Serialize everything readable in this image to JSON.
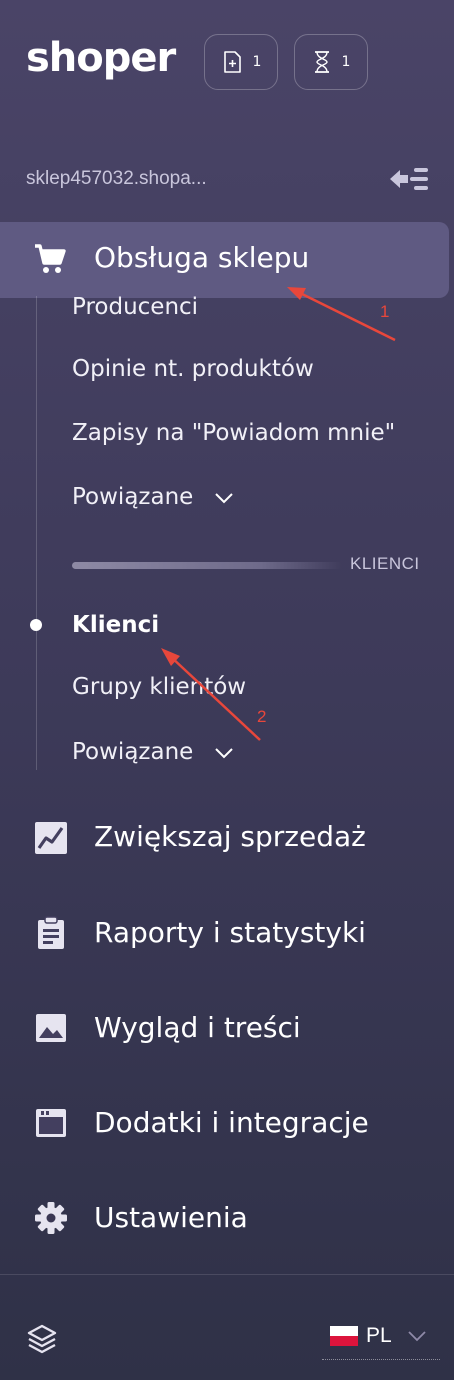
{
  "header": {
    "logo": "shoper",
    "new_badge_count": "1",
    "pending_badge_count": "1"
  },
  "store": {
    "name": "sklep457032.shopa..."
  },
  "active_section": {
    "label": "Obsługa sklepu",
    "items": [
      "Producenci",
      "Opinie nt. produktów",
      "Zapisy na \"Powiadom mnie\"",
      "Powiązane"
    ],
    "section_label": "KLIENCI",
    "client_items": [
      "Klienci",
      "Grupy klientów",
      "Powiązane"
    ]
  },
  "nav": {
    "items": [
      {
        "label": "Zwiększaj sprzedaż",
        "icon": "chart-icon"
      },
      {
        "label": "Raporty i statystyki",
        "icon": "clipboard-icon"
      },
      {
        "label": "Wygląd i treści",
        "icon": "image-icon"
      },
      {
        "label": "Dodatki i integracje",
        "icon": "window-icon"
      },
      {
        "label": "Ustawienia",
        "icon": "gear-icon"
      }
    ]
  },
  "footer": {
    "language": "PL"
  },
  "annotations": [
    "1",
    "2"
  ],
  "colors": {
    "active_bg": "#5f5a82",
    "annotation": "#e8473b"
  }
}
